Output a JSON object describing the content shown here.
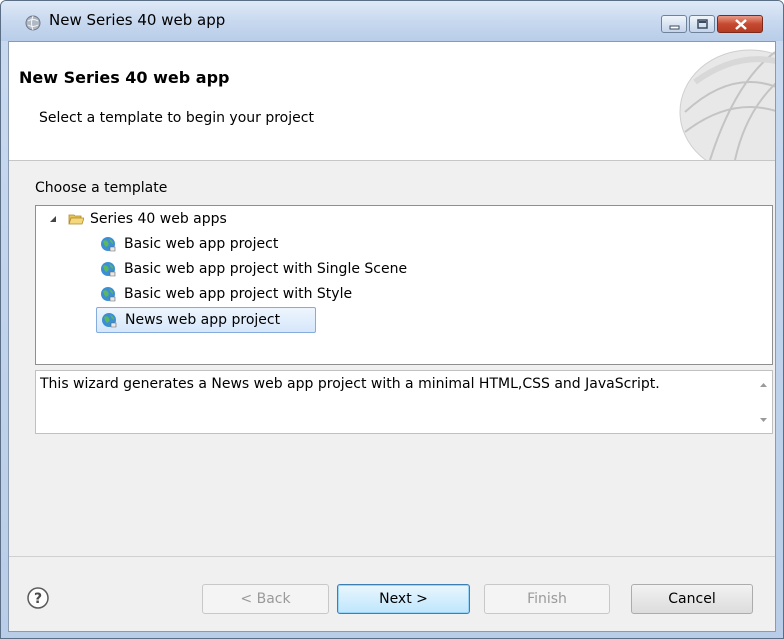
{
  "window": {
    "title": "New Series 40 web app",
    "controls": {
      "minimize": "minimize-icon",
      "maximize": "maximize-icon",
      "close": "close-icon"
    }
  },
  "header": {
    "title": "New Series 40 web app",
    "subtitle": "Select a template to begin your project"
  },
  "templates": {
    "label": "Choose a template",
    "folder": {
      "label": "Series 40 web apps",
      "expanded": true
    },
    "items": [
      {
        "label": "Basic web app project"
      },
      {
        "label": "Basic web app project with Single Scene"
      },
      {
        "label": "Basic web app project with Style"
      },
      {
        "label": "News web app project",
        "selected": true
      }
    ]
  },
  "description": "This wizard generates a News web app project with a minimal HTML,CSS and JavaScript.",
  "buttons": {
    "back": "< Back",
    "next": "Next >",
    "finish": "Finish",
    "cancel": "Cancel"
  },
  "colors": {
    "titlebar": "#c8d9ef",
    "close_button": "#c64a31",
    "selection": "#d6e7fb",
    "primary_button": "#bee6fd"
  }
}
